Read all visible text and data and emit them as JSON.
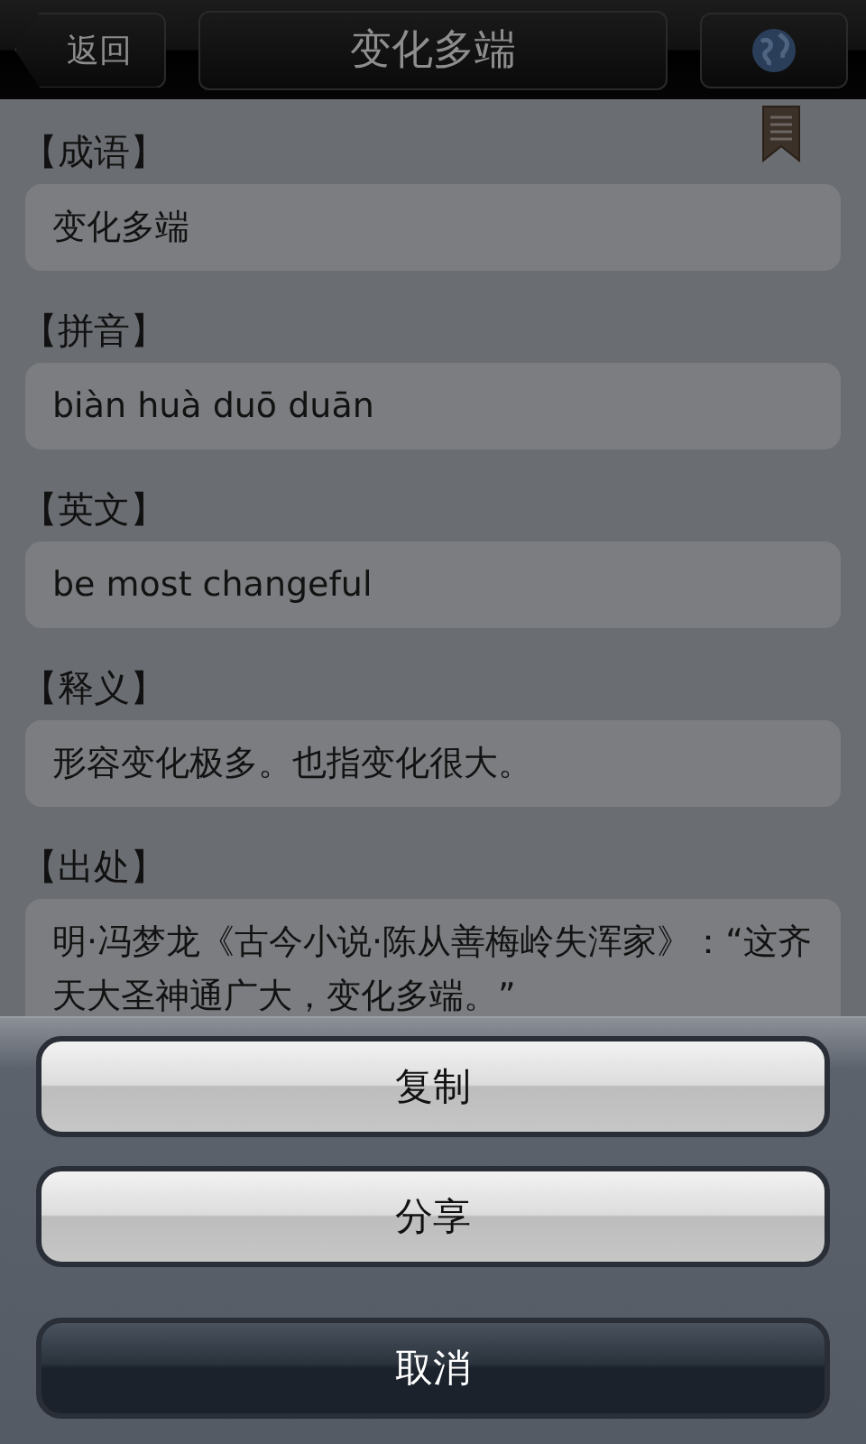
{
  "nav": {
    "back": "返回",
    "title": "变化多端"
  },
  "sections": [
    {
      "label": "【成语】",
      "text": "变化多端"
    },
    {
      "label": "【拼音】",
      "text": "biàn huà duō duān"
    },
    {
      "label": "【英文】",
      "text": "be most changeful"
    },
    {
      "label": "【释义】",
      "text": "形容变化极多。也指变化很大。"
    },
    {
      "label": "【出处】",
      "text": "明·冯梦龙《古今小说·陈从善梅岭失浑家》：“这齐天大圣神通广大，变化多端。”"
    }
  ],
  "action_sheet": [
    {
      "label": "复制",
      "kind": "normal"
    },
    {
      "label": "分享",
      "kind": "normal"
    },
    {
      "label": "取消",
      "kind": "cancel"
    }
  ]
}
